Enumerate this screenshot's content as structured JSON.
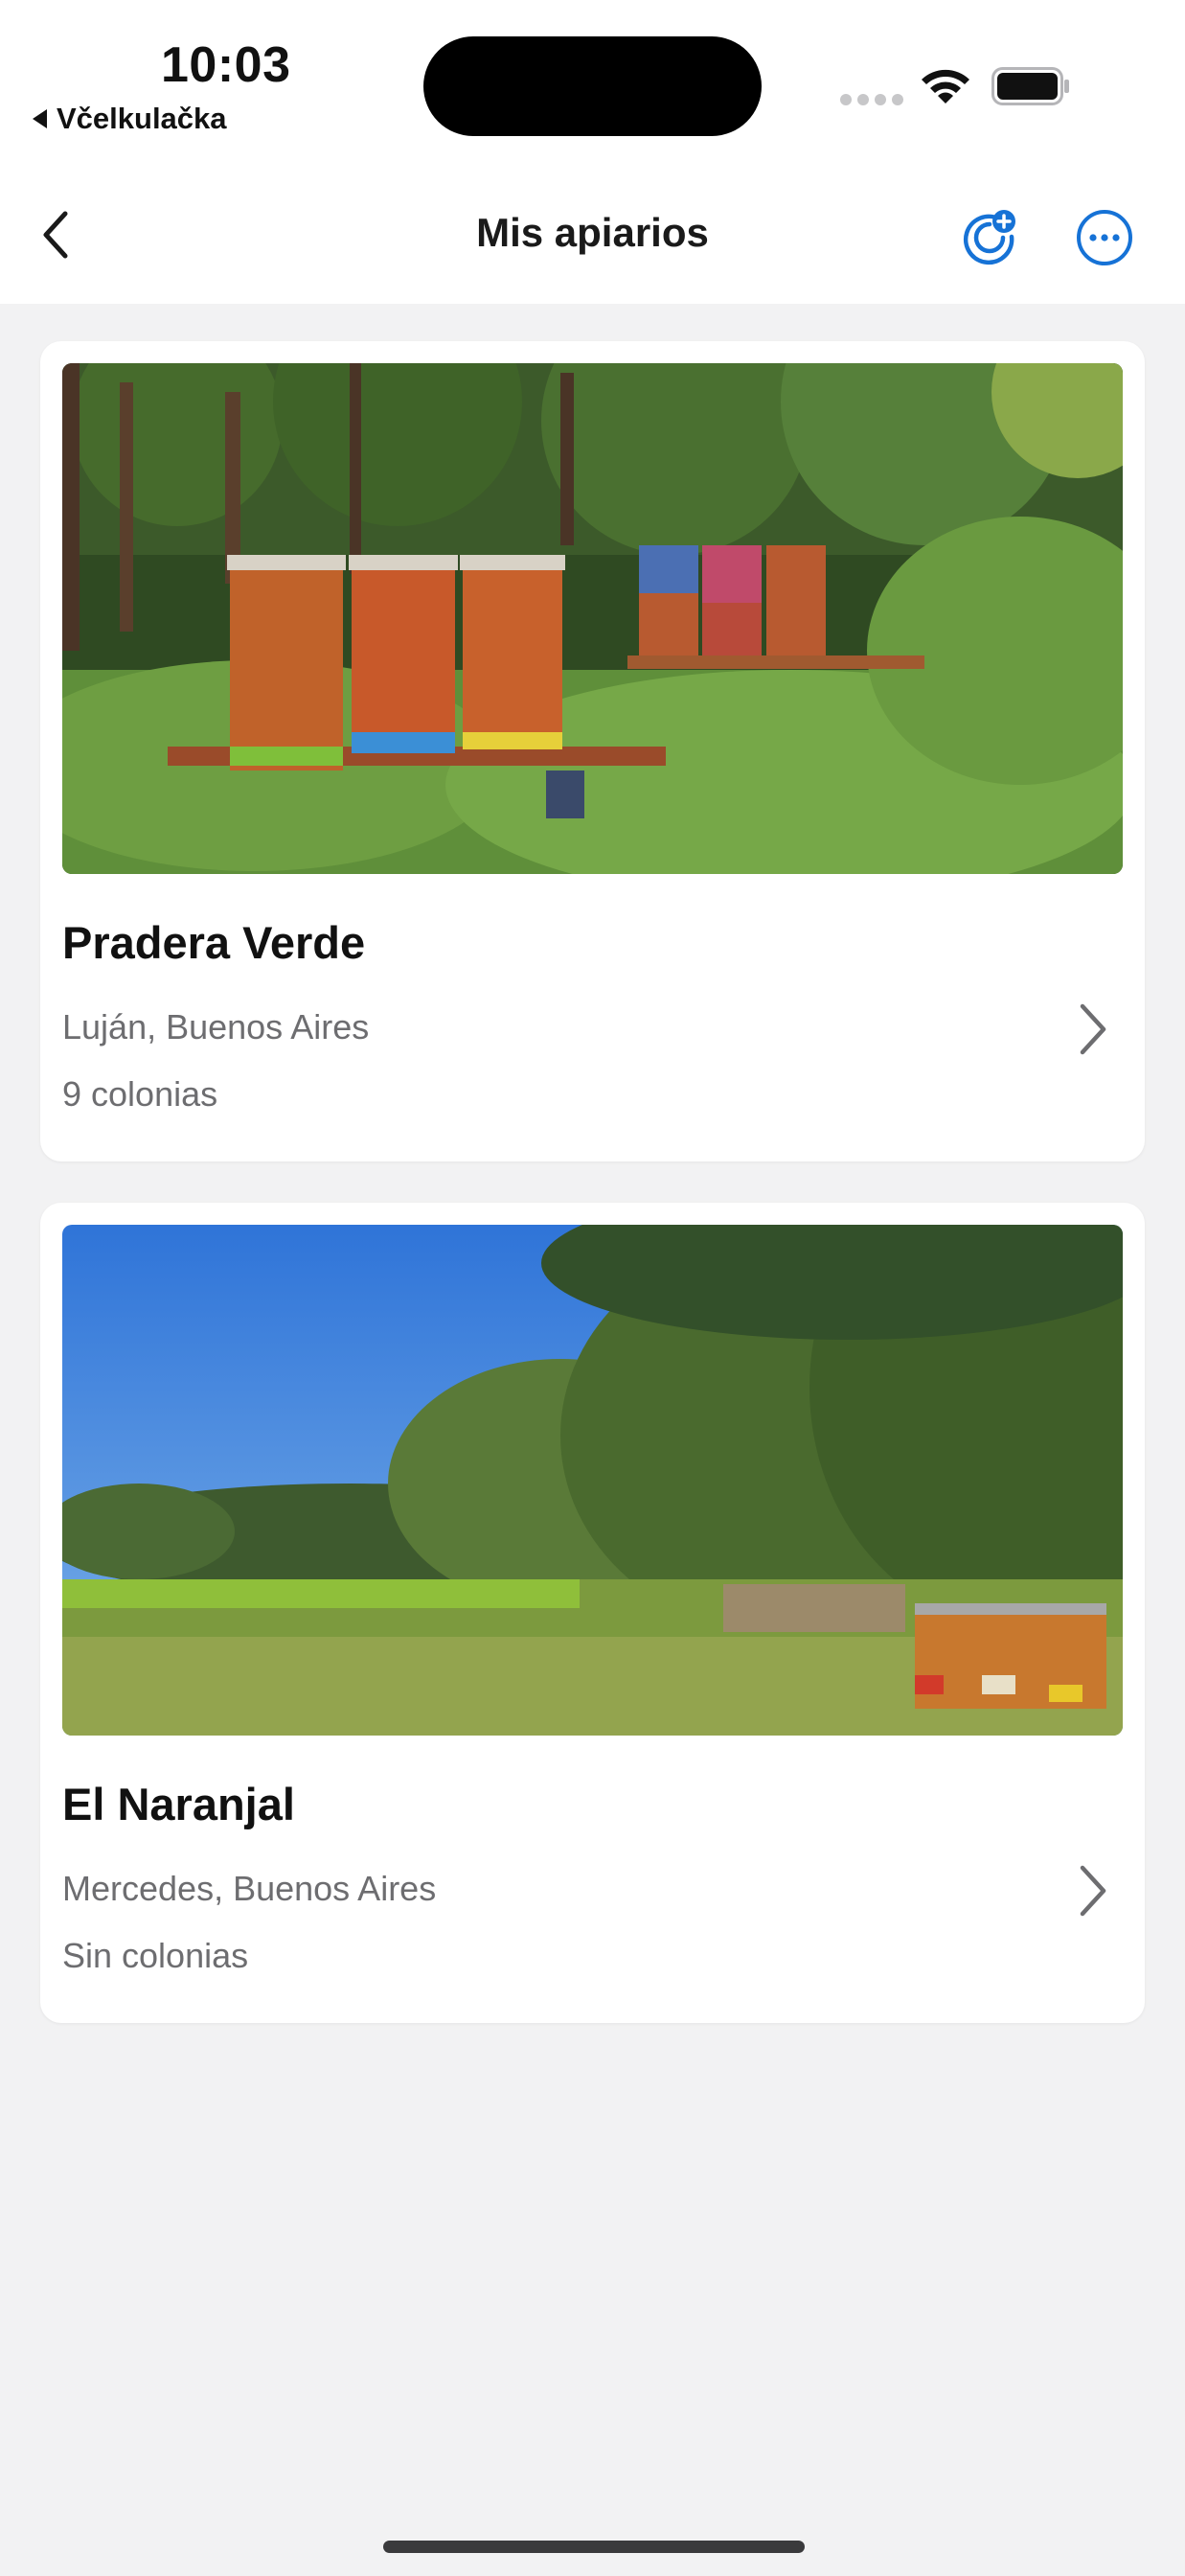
{
  "status_bar": {
    "time": "10:03",
    "back_app": "Včelkulačka",
    "icons": [
      "cellular-signal-icon",
      "wifi-icon",
      "battery-icon"
    ]
  },
  "nav": {
    "title": "Mis apiarios",
    "icons": [
      "chevron-left-icon",
      "add-location-icon",
      "ellipsis-circle-icon"
    ],
    "accent_color": "#1672d6"
  },
  "apiaries": [
    {
      "name": "Pradera Verde",
      "location": "Luján, Buenos Aires",
      "colonies": "9 colonias"
    },
    {
      "name": "El Naranjal",
      "location": "Mercedes, Buenos Aires",
      "colonies": "Sin colonias"
    }
  ]
}
